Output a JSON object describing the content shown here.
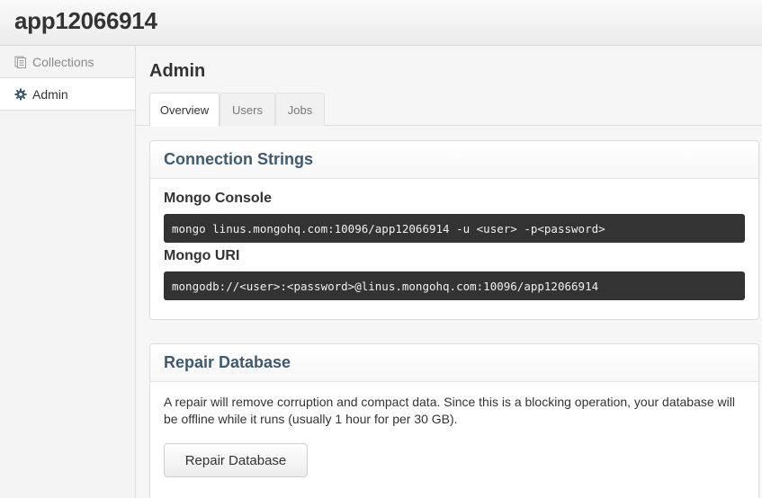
{
  "app": {
    "title": "app12066914"
  },
  "sidebar": {
    "items": [
      {
        "label": "Collections",
        "icon": "document-stack-icon",
        "active": false
      },
      {
        "label": "Admin",
        "icon": "gear-icon",
        "active": true
      }
    ]
  },
  "main": {
    "title": "Admin",
    "tabs": [
      {
        "label": "Overview",
        "active": true
      },
      {
        "label": "Users",
        "active": false
      },
      {
        "label": "Jobs",
        "active": false
      }
    ]
  },
  "connection_strings": {
    "heading": "Connection Strings",
    "console_label": "Mongo Console",
    "console_value": "mongo linus.mongohq.com:10096/app12066914 -u <user> -p<password>",
    "uri_label": "Mongo URI",
    "uri_value": "mongodb://<user>:<password>@linus.mongohq.com:10096/app12066914"
  },
  "repair": {
    "heading": "Repair Database",
    "description": "A repair will remove corruption and compact data. Since this is a blocking operation, your database will be offline while it runs (usually 1 hour for per 30 GB).",
    "button_label": "Repair Database"
  },
  "colors": {
    "panel_heading": "#3e5a71",
    "code_background": "#333333"
  }
}
